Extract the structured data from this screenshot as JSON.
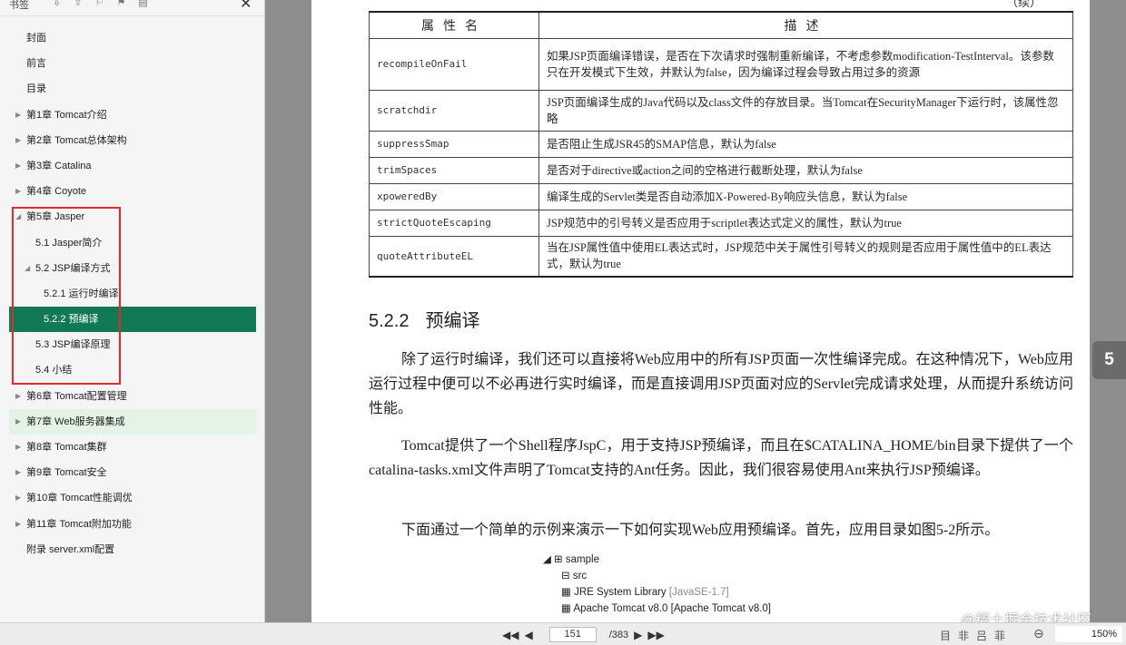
{
  "sidebar": {
    "title": "书签",
    "tool_icons": [
      "⇩",
      "⇧",
      "⚐",
      "⚑",
      "▤"
    ],
    "close": "✕",
    "items": [
      {
        "label": "封面",
        "level": 0,
        "caret": ""
      },
      {
        "label": "前言",
        "level": 0,
        "caret": ""
      },
      {
        "label": "目录",
        "level": 0,
        "caret": ""
      },
      {
        "label": "第1章 Tomcat介绍",
        "level": 0,
        "caret": "▶"
      },
      {
        "label": "第2章 Tomcat总体架构",
        "level": 0,
        "caret": "▶"
      },
      {
        "label": "第3章 Catalina",
        "level": 0,
        "caret": "▶"
      },
      {
        "label": "第4章 Coyote",
        "level": 0,
        "caret": "▶"
      },
      {
        "label": "第5章 Jasper",
        "level": 0,
        "caret": "◢"
      },
      {
        "label": "5.1 Jasper简介",
        "level": 1,
        "caret": ""
      },
      {
        "label": "5.2 JSP编译方式",
        "level": 1,
        "caret": "◢"
      },
      {
        "label": "5.2.1 运行时编译",
        "level": 2,
        "caret": ""
      },
      {
        "label": "5.2.2 预编译",
        "level": 2,
        "caret": "",
        "active": true
      },
      {
        "label": "5.3 JSP编译原理",
        "level": 1,
        "caret": ""
      },
      {
        "label": "5.4 小结",
        "level": 1,
        "caret": ""
      },
      {
        "label": "第6章 Tomcat配置管理",
        "level": 0,
        "caret": "▶"
      },
      {
        "label": "第7章 Web服务器集成",
        "level": 0,
        "caret": "▶",
        "hover": true
      },
      {
        "label": "第8章 Tomcat集群",
        "level": 0,
        "caret": "▶"
      },
      {
        "label": "第9章 Tomcat安全",
        "level": 0,
        "caret": "▶"
      },
      {
        "label": "第10章 Tomcat性能调优",
        "level": 0,
        "caret": "▶"
      },
      {
        "label": "第11章 Tomcat附加功能",
        "level": 0,
        "caret": "▶"
      },
      {
        "label": "附录 server.xml配置",
        "level": 0,
        "caret": ""
      }
    ]
  },
  "document": {
    "continued": "（续）",
    "table": {
      "headers": [
        "属性名",
        "描述"
      ],
      "rows": [
        {
          "key": "recompileOnFail",
          "desc": "如果JSP页面编译错误，是否在下次请求时强制重新编译，不考虑参数modification-TestInterval。该参数只在开发模式下生效，并默认为false，因为编译过程会导致占用过多的资源"
        },
        {
          "key": "scratchdir",
          "desc": "JSP页面编译生成的Java代码以及class文件的存放目录。当Tomcat在SecurityManager下运行时，该属性忽略"
        },
        {
          "key": "suppressSmap",
          "desc": "是否阻止生成JSR45的SMAP信息，默认为false"
        },
        {
          "key": "trimSpaces",
          "desc": "是否对于directive或action之间的空格进行截断处理，默认为false"
        },
        {
          "key": "xpoweredBy",
          "desc": "编译生成的Servlet类是否自动添加X-Powered-By响应头信息，默认为false"
        },
        {
          "key": "strictQuoteEscaping",
          "desc": "JSP规范中的引号转义是否应用于scriptlet表达式定义的属性，默认为true"
        },
        {
          "key": "quoteAttributeEL",
          "desc": "当在JSP属性值中使用EL表达式时，JSP规范中关于属性引号转义的规则是否应用于属性值中的EL表达式，默认为true"
        }
      ]
    },
    "section_number": "5.2.2",
    "section_title": "预编译",
    "paragraphs": [
      "除了运行时编译，我们还可以直接将Web应用中的所有JSP页面一次性编译完成。在这种情况下，Web应用运行过程中便可以不必再进行实时编译，而是直接调用JSP页面对应的Servlet完成请求处理，从而提升系统访问性能。",
      "Tomcat提供了一个Shell程序JspC，用于支持JSP预编译，而且在$CATALINA_HOME/bin目录下提供了一个catalina-tasks.xml文件声明了Tomcat支持的Ant任务。因此，我们很容易使用Ant来执行JSP预编译。",
      "下面通过一个简单的示例来演示一下如何实现Web应用预编译。首先，应用目录如图5-2所示。"
    ],
    "tree": {
      "root": "sample",
      "src": "src",
      "jre": "JRE System Library",
      "jre_tag": "[JavaSE-1.7]",
      "tomcat": "Apache Tomcat v8.0 [Apache Tomcat v8.0]"
    }
  },
  "side_tab": "5",
  "watermark": "@稀土掘金技术社区",
  "statusbar": {
    "current_page": "151",
    "total_pages": "/383",
    "zoom": "150%",
    "view_icons": [
      "目",
      "非",
      "吕",
      "菲"
    ]
  }
}
